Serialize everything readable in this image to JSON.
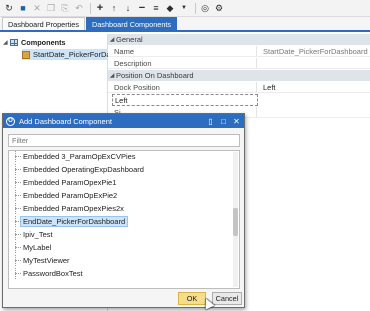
{
  "toolbar": {
    "icons": [
      "refresh-icon",
      "save-icon",
      "delete-icon",
      "copy-icon",
      "paste-icon",
      "undo-icon",
      "add-icon",
      "move-up-icon",
      "move-down-icon",
      "remove-icon",
      "arrange-icon",
      "tag-icon",
      "dropdown-icon",
      "preview-icon",
      "settings-icon"
    ]
  },
  "tabs": [
    {
      "label": "Dashboard Properties",
      "active": false
    },
    {
      "label": "Dashboard Components",
      "active": true
    }
  ],
  "tree": {
    "root_label": "Components",
    "child_label": "StartDate_PickerForDashb"
  },
  "properties": {
    "general_category": "General",
    "name_label": "Name",
    "name_value": "StartDate_PickerForDashboard",
    "description_label": "Description",
    "position_category": "Position On Dashboard",
    "dock_label": "Dock Position",
    "dock_value": "Left",
    "dock_edit_value": "Left",
    "partial_label": "Si..."
  },
  "dialog": {
    "title": "Add Dashboard Component",
    "filter_placeholder": "Filter",
    "items": [
      "Embedded 3_ParamOpExCVPies",
      "Embedded OperatingExpDashboard",
      "Embedded ParamOpexPie1",
      "Embedded ParamOpExPie2",
      "Embedded ParamOpexPies2x",
      "EndDate_PickerForDashboard",
      "Ipiv_Test",
      "MyLabel",
      "MyTestViewer",
      "PasswordBoxTest"
    ],
    "selected_index": 5,
    "ok_label": "OK",
    "cancel_label": "Cancel"
  },
  "colors": {
    "accent": "#2d6dbf",
    "selection": "#cde3f7",
    "ok_button": "#f6dd8c",
    "category_band": "#dfe4eb"
  }
}
